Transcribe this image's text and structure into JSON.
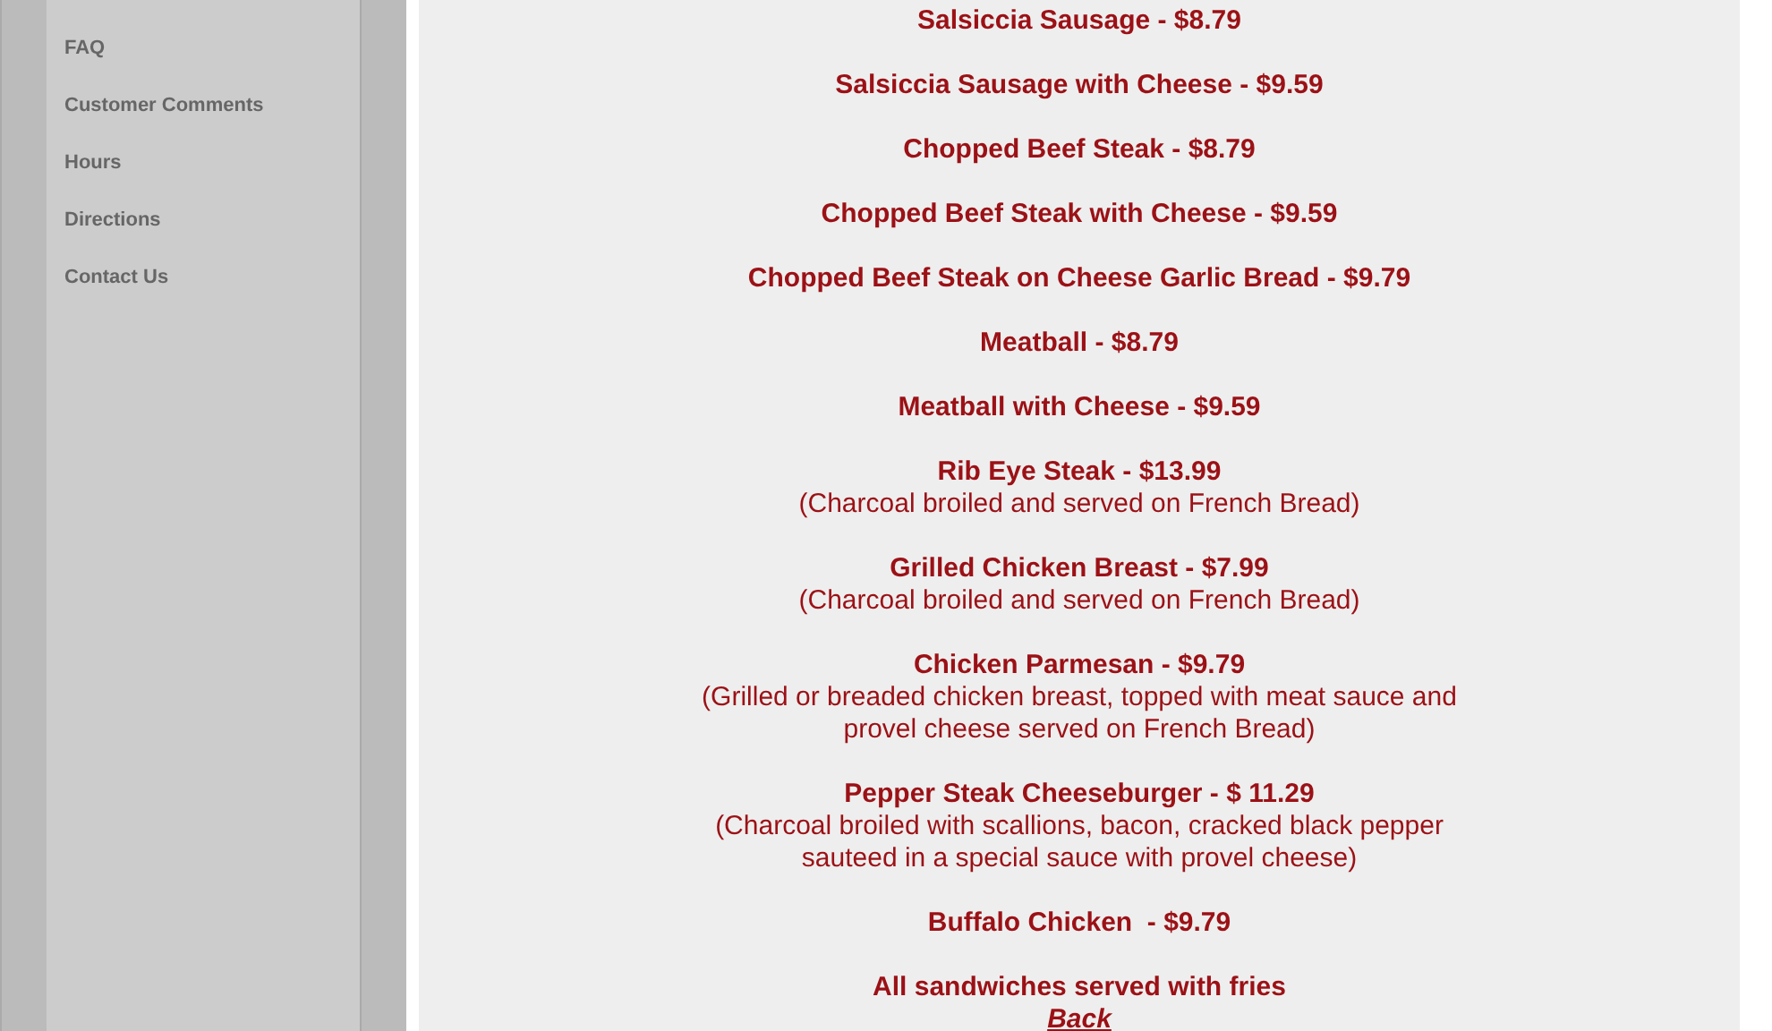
{
  "sidebar": {
    "items": [
      {
        "label": "FAQ"
      },
      {
        "label": "Customer Comments"
      },
      {
        "label": "Hours"
      },
      {
        "label": "Directions"
      },
      {
        "label": "Contact Us"
      }
    ]
  },
  "menu": {
    "items": [
      {
        "name": "Salsiccia Sausage - $8.79"
      },
      {
        "name": "Salsiccia Sausage with Cheese - $9.59"
      },
      {
        "name": "Chopped Beef Steak - $8.79"
      },
      {
        "name": "Chopped Beef Steak with Cheese - $9.59"
      },
      {
        "name": "Chopped Beef Steak on Cheese Garlic Bread - $9.79"
      },
      {
        "name": "Meatball - $8.79"
      },
      {
        "name": "Meatball with Cheese - $9.59"
      },
      {
        "name": "Rib Eye Steak - $13.99",
        "description": "(Charcoal broiled and served on French Bread)"
      },
      {
        "name": "Grilled Chicken Breast - $7.99",
        "description": "(Charcoal broiled and served on French Bread)"
      },
      {
        "name": "Chicken Parmesan - $9.79",
        "description": "(Grilled or breaded chicken breast, topped with meat sauce and provel cheese served on French Bread)"
      },
      {
        "name": "Pepper Steak Cheeseburger - $ 11.29",
        "description": "(Charcoal broiled with scallions, bacon, cracked black pepper sauteed in a special sauce with provel cheese)"
      },
      {
        "name": "Buffalo Chicken  - $9.79"
      }
    ],
    "note": "All sandwiches served with fries",
    "back_link": "Back"
  }
}
